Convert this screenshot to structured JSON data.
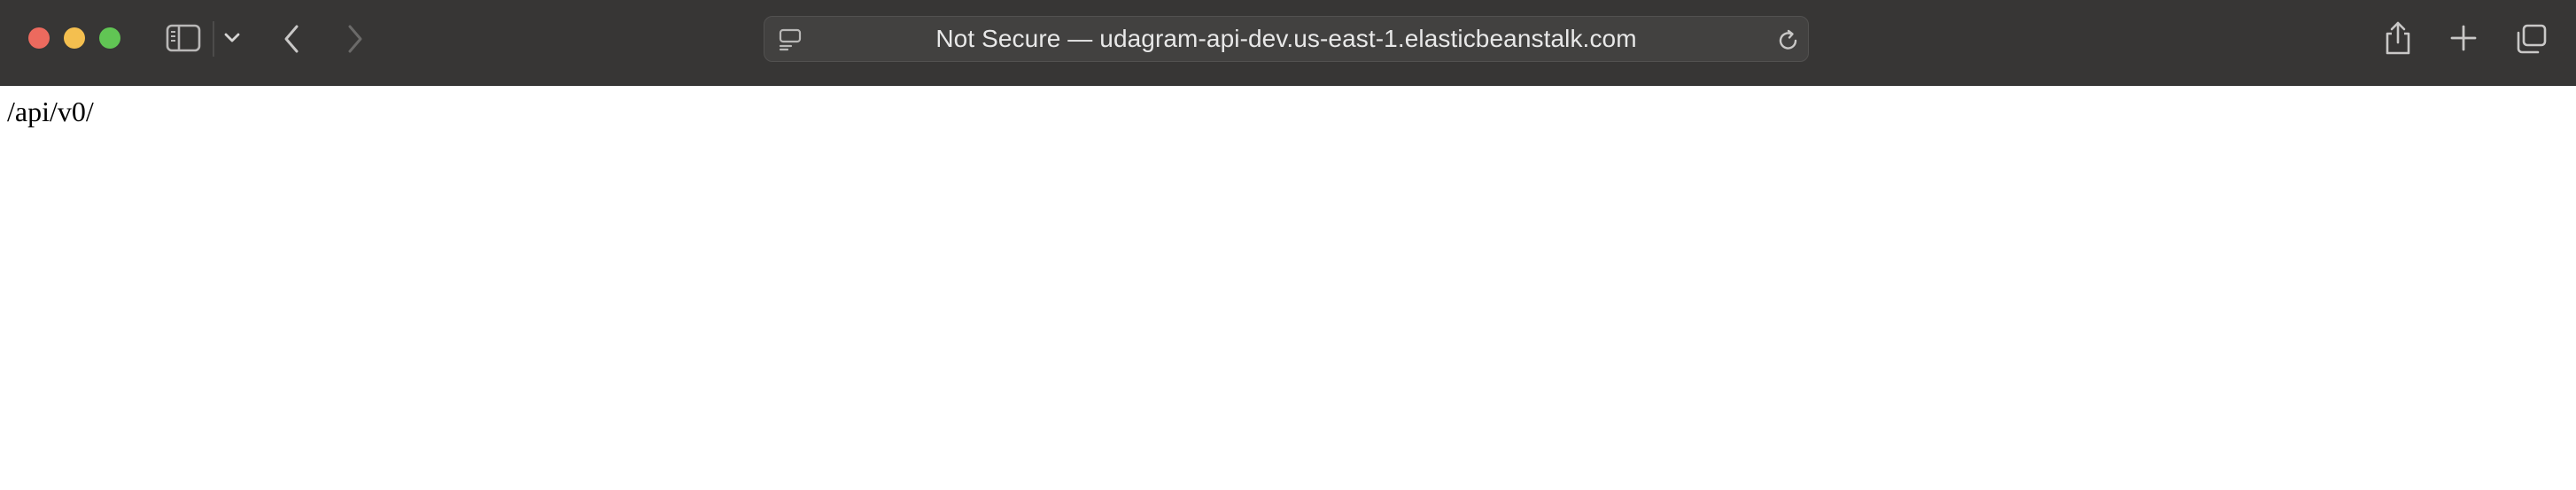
{
  "browser": {
    "window_controls": [
      "close",
      "minimize",
      "maximize"
    ],
    "toolbar_icons": {
      "sidebar": "sidebar-icon",
      "tab_overview_menu": "chevron-down-icon",
      "back": "chevron-left-icon",
      "forward": "chevron-right-icon",
      "reader": "reader-mode-icon",
      "reload": "reload-icon",
      "share": "share-icon",
      "new_tab": "plus-icon",
      "tabs": "tab-overview-icon"
    },
    "address_bar": {
      "text": "Not Secure — udagram-api-dev.us-east-1.elasticbeanstalk.com"
    },
    "colors": {
      "toolbar_bg": "#373635",
      "address_bg": "#424140",
      "close": "#ec6a5e",
      "minimize": "#f4bf4f",
      "maximize": "#61c554"
    }
  },
  "page": {
    "body_text": "/api/v0/"
  }
}
